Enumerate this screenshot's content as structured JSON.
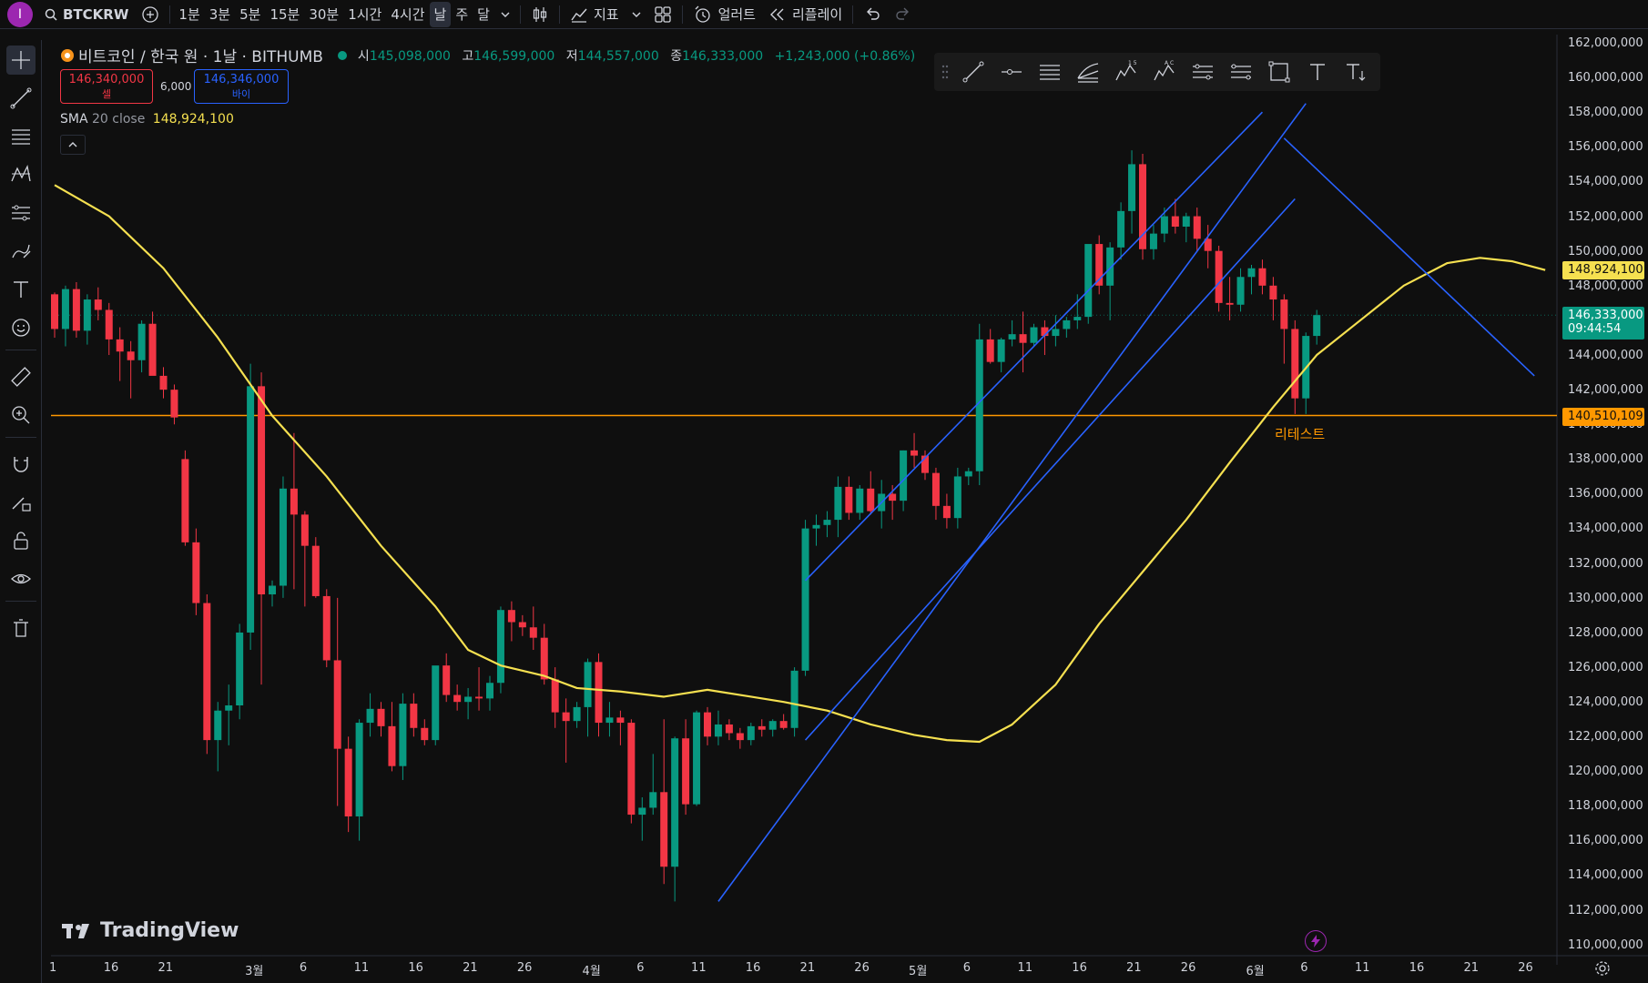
{
  "top_bar": {
    "avatar_letter": "I",
    "symbol": "BTCKRW",
    "intervals": [
      "1분",
      "3분",
      "5분",
      "15분",
      "30분",
      "1시간",
      "4시간",
      "날",
      "주",
      "달"
    ],
    "active_interval": "날",
    "indicators_label": "지표",
    "alert_label": "얼러트",
    "replay_label": "리플레이"
  },
  "legend": {
    "title": "비트코인 / 한국 원 · 1날 · BITHUMB",
    "open_key": "시",
    "open": "145,098,000",
    "high_key": "고",
    "high": "146,599,000",
    "low_key": "저",
    "low": "144,557,000",
    "close_key": "종",
    "close": "146,333,000",
    "change": "+1,243,000 (+0.86%)",
    "sell_price": "146,340,000",
    "sell_label": "셀",
    "spread": "6,000",
    "buy_price": "146,346,000",
    "buy_label": "바이",
    "sma_name": "SMA",
    "sma_params": "20 close",
    "sma_value": "148,924,100"
  },
  "price_tags": {
    "sma": "148,924,100",
    "last_price": "146,333,000",
    "countdown": "09:44:54",
    "support": "140,510,109"
  },
  "annotations": {
    "retest": "리테스트"
  },
  "branding": {
    "logo_text": "TradingView"
  },
  "colors": {
    "up": "#089981",
    "down": "#f23645",
    "sma": "#f5e050",
    "trendline": "#2962ff",
    "support": "#ff9800",
    "background": "#0f0f0f"
  },
  "chart_data": {
    "type": "candlestick",
    "title": "비트코인 / 한국 원 · 1날 · BITHUMB",
    "y_axis_ticks": [
      "162,000,000",
      "160,000,000",
      "158,000,000",
      "156,000,000",
      "154,000,000",
      "152,000,000",
      "150,000,000",
      "148,000,000",
      "146,000,000",
      "144,000,000",
      "142,000,000",
      "140,000,000",
      "138,000,000",
      "136,000,000",
      "134,000,000",
      "132,000,000",
      "130,000,000",
      "128,000,000",
      "126,000,000",
      "124,000,000",
      "122,000,000",
      "120,000,000",
      "118,000,000",
      "116,000,000",
      "114,000,000",
      "112,000,000",
      "110,000,000"
    ],
    "ylim": [
      109000000,
      163000000
    ],
    "x_axis_ticks": [
      {
        "label": "1",
        "day": 0
      },
      {
        "label": "16",
        "day": 5
      },
      {
        "label": "21",
        "day": 10
      },
      {
        "label": "3월",
        "day": 18
      },
      {
        "label": "6",
        "day": 23
      },
      {
        "label": "11",
        "day": 28
      },
      {
        "label": "16",
        "day": 33
      },
      {
        "label": "21",
        "day": 38
      },
      {
        "label": "26",
        "day": 43
      },
      {
        "label": "4월",
        "day": 49
      },
      {
        "label": "6",
        "day": 54
      },
      {
        "label": "11",
        "day": 59
      },
      {
        "label": "16",
        "day": 64
      },
      {
        "label": "21",
        "day": 69
      },
      {
        "label": "26",
        "day": 74
      },
      {
        "label": "5월",
        "day": 79
      },
      {
        "label": "6",
        "day": 84
      },
      {
        "label": "11",
        "day": 89
      },
      {
        "label": "16",
        "day": 94
      },
      {
        "label": "21",
        "day": 99
      },
      {
        "label": "26",
        "day": 104
      },
      {
        "label": "6월",
        "day": 110
      },
      {
        "label": "6",
        "day": 115
      },
      {
        "label": "11",
        "day": 120
      },
      {
        "label": "16",
        "day": 125
      },
      {
        "label": "21",
        "day": 130
      },
      {
        "label": "26",
        "day": 135
      }
    ],
    "candles": [
      [
        147.5,
        147.6,
        145.0,
        145.5
      ],
      [
        145.5,
        148.0,
        144.5,
        147.8
      ],
      [
        147.8,
        148.2,
        145.0,
        145.4
      ],
      [
        145.4,
        147.5,
        144.6,
        147.2
      ],
      [
        147.2,
        147.9,
        146.0,
        146.6
      ],
      [
        146.6,
        147.0,
        144.0,
        144.9
      ],
      [
        144.9,
        145.6,
        142.5,
        144.2
      ],
      [
        144.2,
        144.8,
        141.5,
        143.7
      ],
      [
        143.7,
        146.0,
        143.0,
        145.8
      ],
      [
        145.8,
        146.5,
        143.0,
        142.8
      ],
      [
        142.8,
        143.3,
        141.5,
        142.0
      ],
      [
        142.0,
        142.3,
        140.0,
        140.4
      ],
      [
        138.0,
        138.5,
        133.0,
        133.2
      ],
      [
        133.2,
        134.0,
        129.0,
        129.7
      ],
      [
        129.7,
        130.2,
        121.0,
        121.8
      ],
      [
        121.8,
        124.0,
        120.0,
        123.5
      ],
      [
        123.5,
        125.0,
        121.5,
        123.8
      ],
      [
        123.8,
        128.5,
        123.0,
        128.0
      ],
      [
        128.0,
        143.5,
        127.0,
        142.2
      ],
      [
        142.2,
        143.0,
        125.0,
        130.2
      ],
      [
        130.2,
        131.0,
        129.5,
        130.7
      ],
      [
        130.7,
        137.0,
        130.0,
        136.3
      ],
      [
        136.3,
        139.5,
        130.5,
        134.8
      ],
      [
        134.8,
        135.0,
        129.5,
        133.0
      ],
      [
        133.0,
        133.5,
        130.0,
        130.1
      ],
      [
        130.1,
        130.5,
        126.0,
        126.4
      ],
      [
        126.4,
        130.0,
        118.0,
        121.3
      ],
      [
        121.3,
        122.0,
        116.5,
        117.4
      ],
      [
        117.4,
        123.0,
        116.0,
        122.8
      ],
      [
        122.8,
        124.5,
        122.0,
        123.6
      ],
      [
        123.6,
        124.0,
        122.0,
        122.6
      ],
      [
        122.6,
        124.0,
        120.0,
        120.3
      ],
      [
        120.3,
        124.5,
        119.5,
        123.9
      ],
      [
        123.9,
        124.5,
        122.0,
        122.5
      ],
      [
        122.5,
        123.0,
        121.5,
        121.8
      ],
      [
        121.8,
        126.0,
        121.5,
        126.1
      ],
      [
        126.1,
        126.8,
        124.0,
        124.4
      ],
      [
        124.4,
        125.0,
        123.5,
        124.0
      ],
      [
        124.0,
        124.8,
        123.0,
        124.3
      ],
      [
        124.3,
        126.0,
        123.5,
        124.2
      ],
      [
        124.2,
        125.5,
        123.5,
        125.1
      ],
      [
        125.1,
        129.5,
        124.5,
        129.3
      ],
      [
        129.3,
        129.8,
        127.5,
        128.6
      ],
      [
        128.6,
        129.0,
        127.8,
        128.3
      ],
      [
        128.3,
        129.5,
        127.0,
        127.7
      ],
      [
        127.7,
        128.5,
        125.0,
        125.3
      ],
      [
        125.3,
        126.0,
        122.5,
        123.4
      ],
      [
        123.4,
        124.2,
        120.5,
        122.9
      ],
      [
        122.9,
        124.0,
        122.5,
        123.7
      ],
      [
        123.7,
        126.5,
        122.0,
        126.3
      ],
      [
        126.3,
        126.8,
        122.0,
        122.8
      ],
      [
        122.8,
        124.0,
        122.0,
        123.1
      ],
      [
        123.1,
        123.5,
        121.5,
        122.8
      ],
      [
        122.8,
        123.0,
        117.0,
        117.5
      ],
      [
        117.5,
        118.5,
        116.0,
        117.9
      ],
      [
        117.9,
        121.0,
        117.5,
        118.8
      ],
      [
        118.8,
        123.0,
        113.5,
        114.5
      ],
      [
        114.5,
        122.0,
        112.5,
        121.9
      ],
      [
        121.9,
        123.0,
        117.5,
        118.1
      ],
      [
        118.1,
        123.5,
        118.0,
        123.4
      ],
      [
        123.4,
        123.7,
        121.5,
        122.0
      ],
      [
        122.0,
        123.5,
        121.5,
        122.7
      ],
      [
        122.7,
        123.0,
        121.8,
        122.2
      ],
      [
        122.2,
        122.5,
        121.3,
        121.8
      ],
      [
        121.8,
        122.8,
        121.5,
        122.6
      ],
      [
        122.6,
        123.0,
        122.0,
        122.4
      ],
      [
        122.4,
        123.0,
        122.0,
        122.9
      ],
      [
        122.9,
        123.3,
        122.4,
        122.5
      ],
      [
        122.5,
        126.0,
        122.0,
        125.8
      ],
      [
        125.8,
        134.5,
        125.5,
        134.0
      ],
      [
        134.0,
        134.8,
        133.0,
        134.2
      ],
      [
        134.2,
        135.0,
        133.5,
        134.5
      ],
      [
        134.5,
        137.0,
        133.5,
        136.4
      ],
      [
        136.4,
        137.0,
        134.5,
        134.9
      ],
      [
        134.9,
        136.5,
        134.5,
        136.3
      ],
      [
        136.3,
        137.3,
        134.8,
        135.0
      ],
      [
        135.0,
        136.8,
        134.0,
        136.0
      ],
      [
        136.0,
        136.5,
        134.5,
        135.6
      ],
      [
        135.6,
        138.5,
        135.0,
        138.5
      ],
      [
        138.5,
        139.5,
        137.5,
        138.2
      ],
      [
        138.2,
        138.5,
        136.8,
        137.2
      ],
      [
        137.2,
        137.5,
        134.5,
        135.3
      ],
      [
        135.3,
        136.0,
        134.0,
        134.6
      ],
      [
        134.6,
        137.5,
        134.0,
        137.0
      ],
      [
        137.0,
        137.5,
        136.5,
        137.3
      ],
      [
        137.3,
        145.8,
        136.5,
        144.9
      ],
      [
        144.9,
        145.5,
        143.5,
        143.6
      ],
      [
        143.6,
        145.0,
        143.0,
        144.9
      ],
      [
        144.9,
        146.0,
        144.5,
        145.2
      ],
      [
        145.2,
        146.5,
        143.0,
        144.7
      ],
      [
        144.7,
        145.8,
        144.5,
        145.6
      ],
      [
        145.6,
        146.0,
        144.0,
        145.1
      ],
      [
        145.1,
        146.3,
        144.5,
        145.5
      ],
      [
        145.5,
        146.2,
        145.0,
        146.0
      ],
      [
        146.0,
        147.5,
        145.5,
        146.2
      ],
      [
        146.2,
        148.0,
        145.8,
        150.4
      ],
      [
        150.4,
        150.9,
        147.5,
        148.0
      ],
      [
        148.0,
        150.5,
        146.0,
        150.2
      ],
      [
        150.2,
        152.8,
        149.5,
        152.3
      ],
      [
        152.3,
        155.8,
        151.0,
        155.0
      ],
      [
        155.0,
        155.6,
        149.5,
        150.1
      ],
      [
        150.1,
        151.5,
        149.5,
        151.0
      ],
      [
        151.0,
        152.5,
        150.5,
        152.0
      ],
      [
        152.0,
        153.0,
        151.0,
        151.4
      ],
      [
        151.4,
        152.2,
        150.5,
        152.0
      ],
      [
        152.0,
        152.5,
        150.0,
        150.7
      ],
      [
        150.7,
        151.5,
        149.0,
        150.0
      ],
      [
        150.0,
        150.3,
        146.5,
        147.0
      ],
      [
        147.0,
        148.5,
        146.0,
        146.9
      ],
      [
        146.9,
        149.0,
        146.5,
        148.5
      ],
      [
        148.5,
        149.2,
        147.5,
        149.0
      ],
      [
        149.0,
        149.5,
        147.5,
        148.0
      ],
      [
        148.0,
        148.5,
        146.0,
        147.2
      ],
      [
        147.2,
        147.5,
        143.5,
        145.5
      ],
      [
        145.5,
        146.0,
        140.6,
        141.5
      ],
      [
        141.5,
        145.3,
        140.6,
        145.1
      ],
      [
        145.1,
        146.6,
        144.6,
        146.3
      ]
    ],
    "sma": [
      [
        0,
        153.8
      ],
      [
        5,
        152.0
      ],
      [
        10,
        149.0
      ],
      [
        15,
        145.0
      ],
      [
        20,
        140.5
      ],
      [
        25,
        137.0
      ],
      [
        30,
        133.0
      ],
      [
        35,
        129.5
      ],
      [
        38,
        127.0
      ],
      [
        41,
        126.1
      ],
      [
        45,
        125.5
      ],
      [
        48,
        124.8
      ],
      [
        52,
        124.6
      ],
      [
        56,
        124.3
      ],
      [
        60,
        124.7
      ],
      [
        64,
        124.3
      ],
      [
        67,
        124.0
      ],
      [
        71,
        123.5
      ],
      [
        75,
        122.7
      ],
      [
        79,
        122.1
      ],
      [
        82,
        121.8
      ],
      [
        85,
        121.7
      ],
      [
        88,
        122.7
      ],
      [
        92,
        125.0
      ],
      [
        96,
        128.5
      ],
      [
        100,
        131.5
      ],
      [
        104,
        134.5
      ],
      [
        108,
        137.8
      ],
      [
        112,
        141.0
      ],
      [
        116,
        144.0
      ],
      [
        120,
        146.0
      ],
      [
        124,
        148.0
      ],
      [
        128,
        149.3
      ],
      [
        131,
        149.6
      ],
      [
        134,
        149.4
      ],
      [
        137,
        148.9
      ]
    ],
    "support_level": 140510109,
    "trendlines": [
      {
        "from": [
          61,
          112.5
        ],
        "to": [
          115,
          158.5
        ]
      },
      {
        "from": [
          69,
          131.0
        ],
        "to": [
          111,
          158.0
        ]
      },
      {
        "from": [
          69,
          121.8
        ],
        "to": [
          114,
          153.0
        ]
      },
      {
        "from": [
          113,
          156.5
        ],
        "to": [
          136,
          142.8
        ]
      }
    ]
  }
}
